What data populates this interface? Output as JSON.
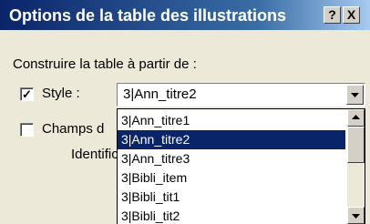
{
  "window": {
    "title": "Options de la table des illustrations",
    "help_label": "?",
    "close_label": "X"
  },
  "build_group": {
    "label": "Construire la table à partir de :"
  },
  "style_option": {
    "checked": true,
    "check_mark": "✓",
    "label": "Style :",
    "value": "3|Ann_titre2"
  },
  "fields_option": {
    "checked": false,
    "label": "Champs d",
    "identifier_label": "Identificat"
  },
  "style_dropdown": {
    "items": [
      {
        "label": "3|Ann_titre1",
        "selected": false
      },
      {
        "label": "3|Ann_titre2",
        "selected": true
      },
      {
        "label": "3|Ann_titre3",
        "selected": false
      },
      {
        "label": "3|Bibli_item",
        "selected": false
      },
      {
        "label": "3|Bibli_tit1",
        "selected": false
      },
      {
        "label": "3|Bibli_tit2",
        "selected": false
      }
    ]
  },
  "colors": {
    "titlebar_start": "#0a246a",
    "titlebar_end": "#a6caf0",
    "selection": "#0a246a",
    "dialog_bg": "#ece9d8"
  }
}
